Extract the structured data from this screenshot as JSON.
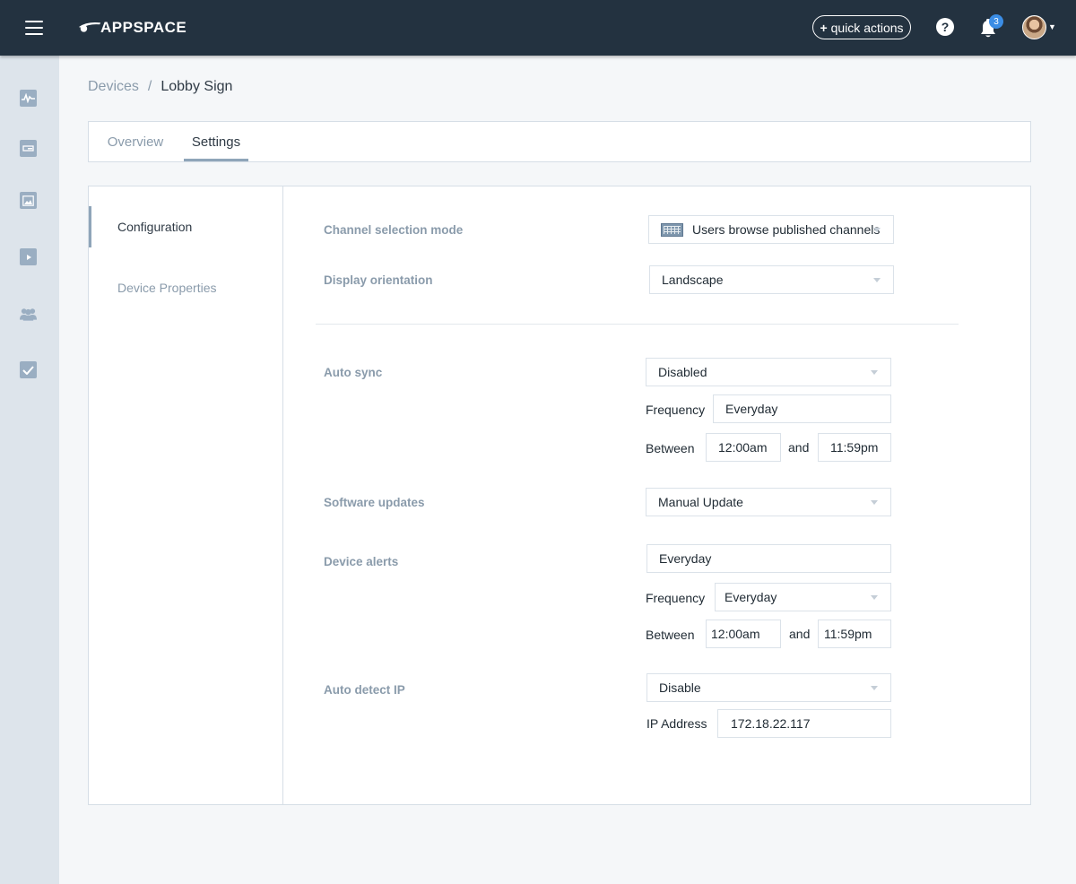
{
  "header": {
    "logo_text": "APPSPACE",
    "quick_actions_label": "quick actions",
    "notification_count": "3",
    "help_glyph": "?",
    "colors": {
      "bar": "#233240",
      "badge": "#3b8de5"
    }
  },
  "rail": {
    "items": [
      {
        "icon": "activity-icon"
      },
      {
        "icon": "devices-icon"
      },
      {
        "icon": "image-library-icon"
      },
      {
        "icon": "channels-icon"
      },
      {
        "icon": "users-icon"
      },
      {
        "icon": "tasks-check-icon"
      }
    ]
  },
  "breadcrumb": {
    "parent": "Devices",
    "separator": "/",
    "current": "Lobby Sign"
  },
  "tabs": {
    "overview": "Overview",
    "settings": "Settings"
  },
  "subnav": {
    "configuration": "Configuration",
    "device_properties": "Device Properties"
  },
  "settings": {
    "channel_selection": {
      "label": "Channel selection mode",
      "value": "Users browse published channels"
    },
    "display_orientation": {
      "label": "Display orientation",
      "value": "Landscape"
    },
    "auto_sync": {
      "label": "Auto sync",
      "value": "Disabled",
      "frequency_label": "Frequency",
      "frequency_value": "Everyday",
      "between_label": "Between",
      "start": "12:00am",
      "and_label": "and",
      "end": "11:59pm"
    },
    "software_updates": {
      "label": "Software updates",
      "value": "Manual Update"
    },
    "device_alerts": {
      "label": "Device alerts",
      "value": "Everyday",
      "frequency_label": "Frequency",
      "frequency_value": "Everyday",
      "between_label": "Between",
      "start": "12:00am",
      "and_label": "and",
      "end": "11:59pm"
    },
    "auto_detect_ip": {
      "label": "Auto detect IP",
      "value": "Disable",
      "ip_label": "IP Address",
      "ip_value": "172.18.22.117"
    }
  }
}
